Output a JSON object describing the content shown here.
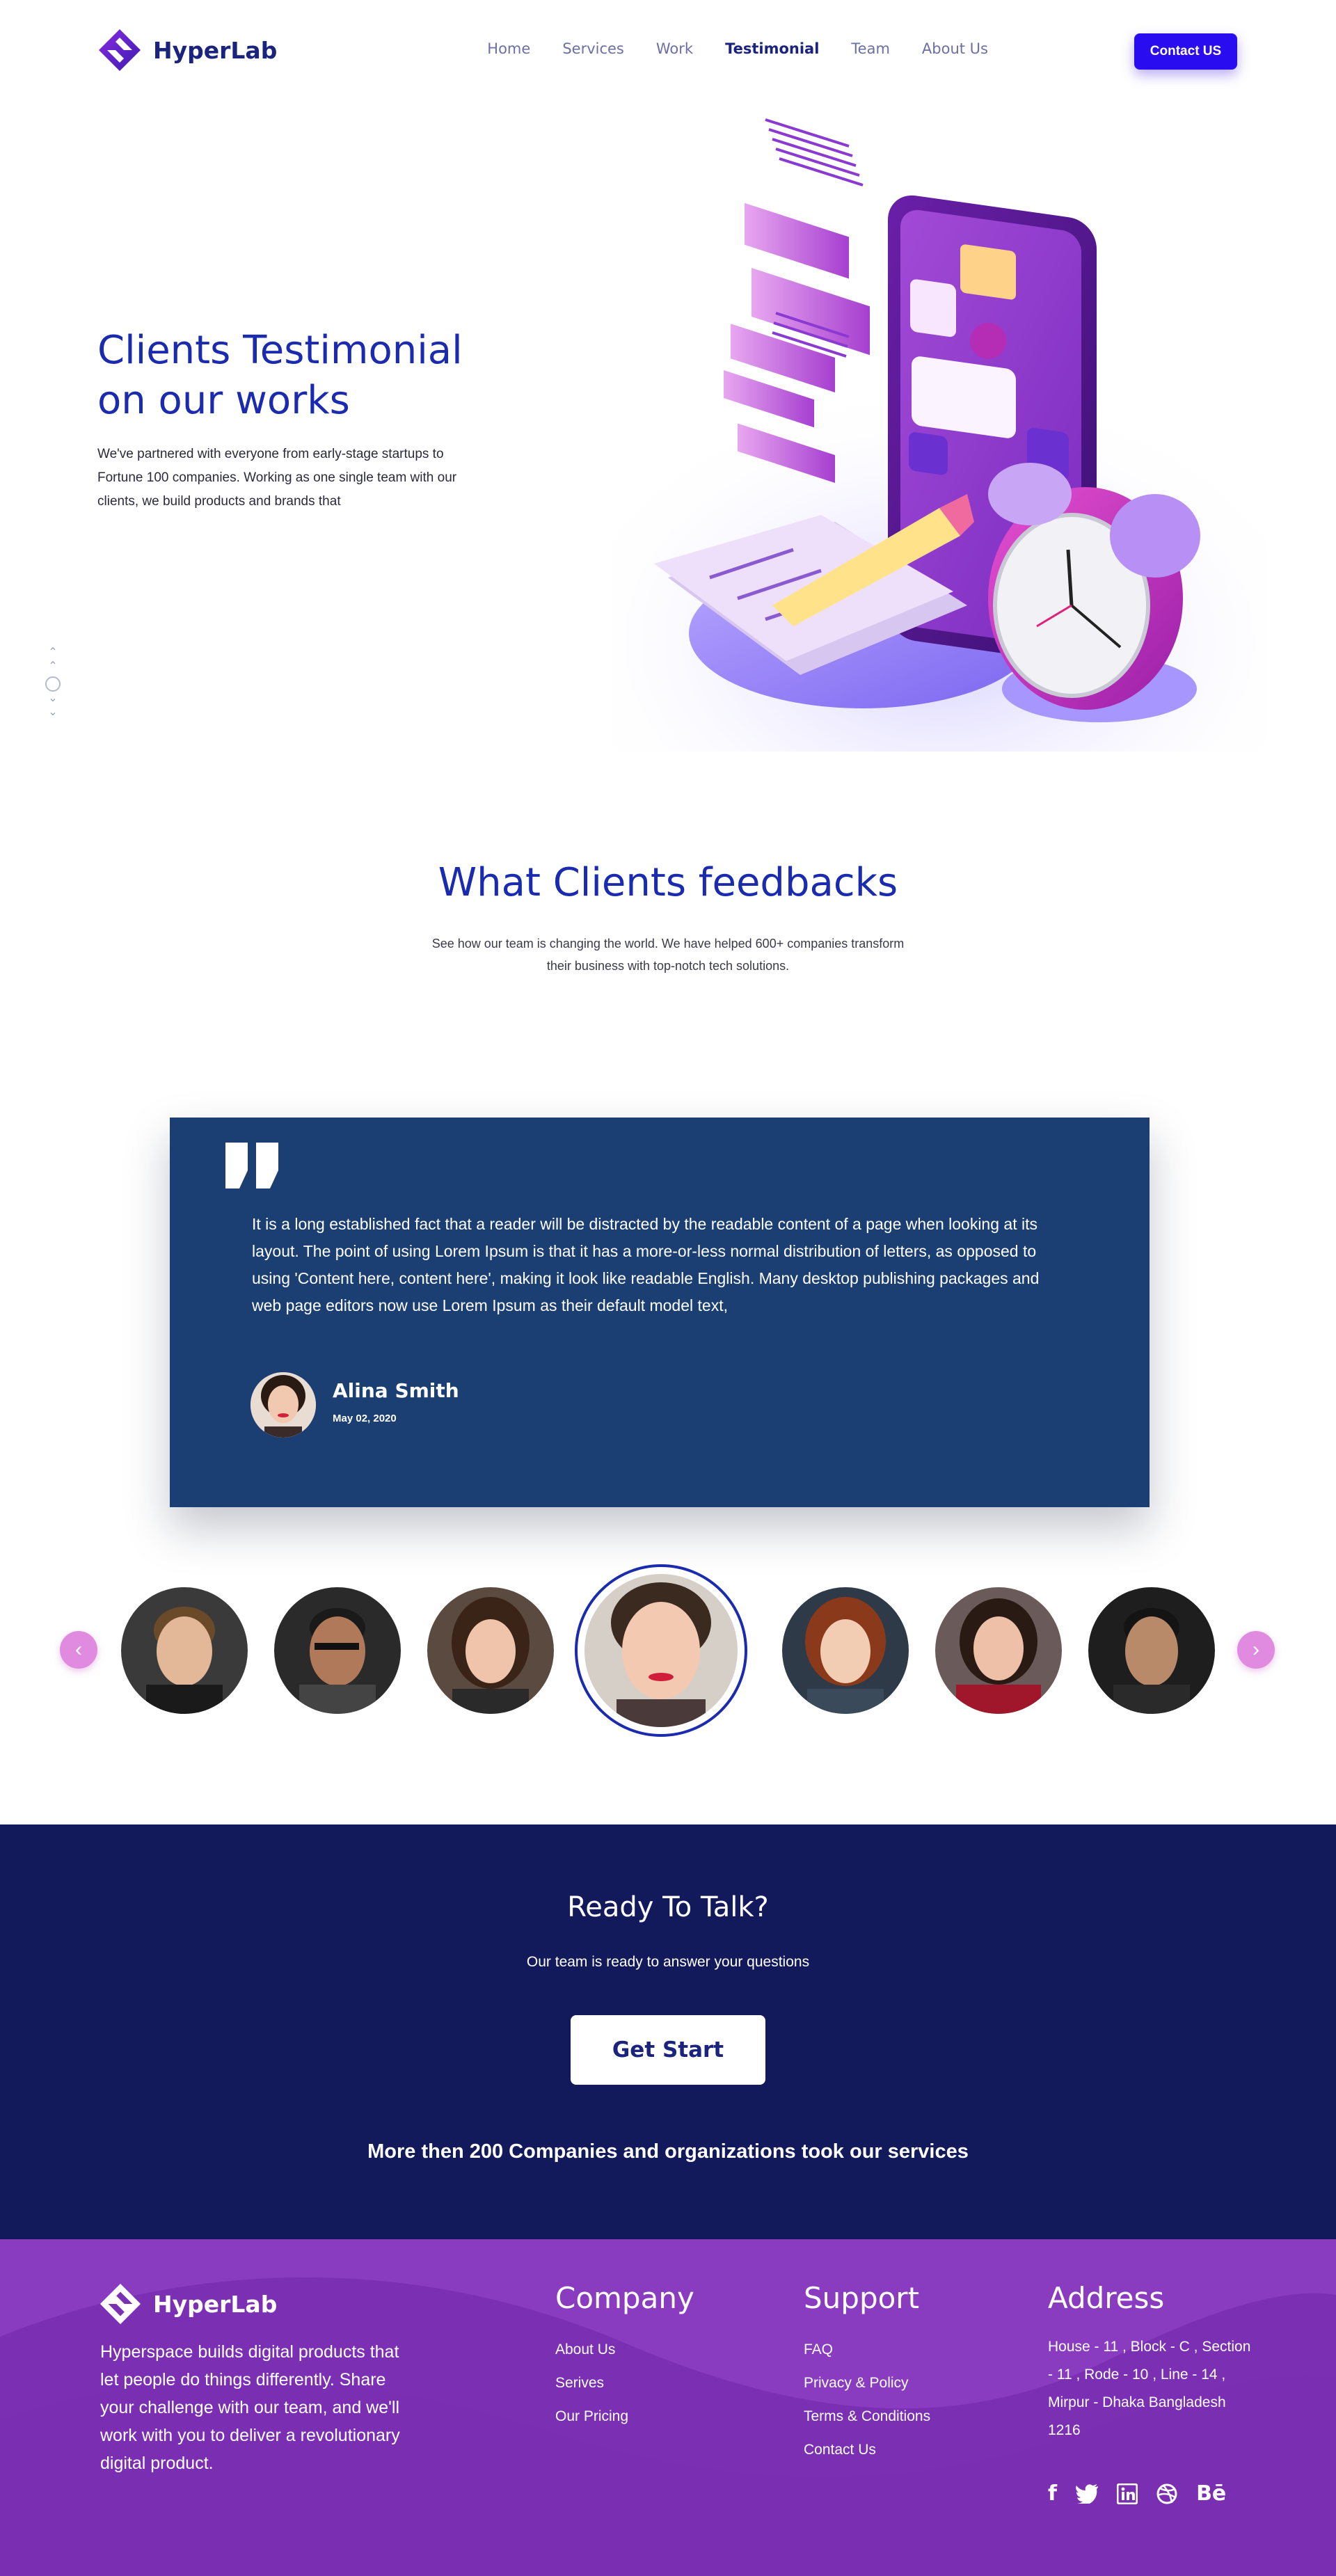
{
  "brand": {
    "name": "HyperLab"
  },
  "nav": {
    "items": [
      "Home",
      "Services",
      "Work",
      "Testimonial",
      "Team",
      "About Us"
    ],
    "active": "Testimonial",
    "contact_label": "Contact US"
  },
  "hero": {
    "title_line1": "Clients Testimonial",
    "title_line2": "on our works",
    "description": "We've partnered with everyone from early-stage startups to Fortune 100 companies. Working as one single team with our clients, we build products and brands that"
  },
  "feedback": {
    "title": "What Clients feedbacks",
    "subtitle": "See how our team is changing the world. We have helped 600+ companies transform their business with top-notch tech solutions."
  },
  "testimonial": {
    "text": "It is a long established fact that a reader will be distracted by the readable content of a page when looking at its layout. The point of using Lorem Ipsum is that it has a more-or-less normal distribution of letters, as opposed to using 'Content here, content here', making it look like readable English. Many desktop publishing packages and web page editors now use Lorem Ipsum as their default model text,",
    "name": "Alina Smith",
    "date": "May 02, 2020"
  },
  "cta": {
    "title": "Ready To Talk?",
    "subtitle": "Our team is ready to answer your questions",
    "button": "Get Start",
    "note": "More then 200 Companies and organizations took our services"
  },
  "footer": {
    "description": "Hyperspace builds digital products that let people do things differently. Share your challenge with our team, and we'll work with you to deliver a revolutionary digital product.",
    "company": {
      "title": "Company",
      "links": [
        "About Us",
        "Serives",
        "Our Pricing"
      ]
    },
    "support": {
      "title": "Support",
      "links": [
        "FAQ",
        "Privacy & Policy",
        "Terms & Conditions",
        "Contact Us"
      ]
    },
    "address": {
      "title": "Address",
      "text": "House - 11 , Block - C , Section - 11 , Rode - 10 , Line - 14 , Mirpur - Dhaka Bangladesh 1216"
    },
    "socials": [
      "facebook-icon",
      "twitter-icon",
      "linkedin-icon",
      "dribbble-icon",
      "behance-icon"
    ]
  },
  "colors": {
    "primary": "#1a2bb0",
    "accent": "#2a0cf0",
    "card": "#1b3f73",
    "cta_bg": "#121a5c",
    "footer_bg": "#7b30b4"
  }
}
